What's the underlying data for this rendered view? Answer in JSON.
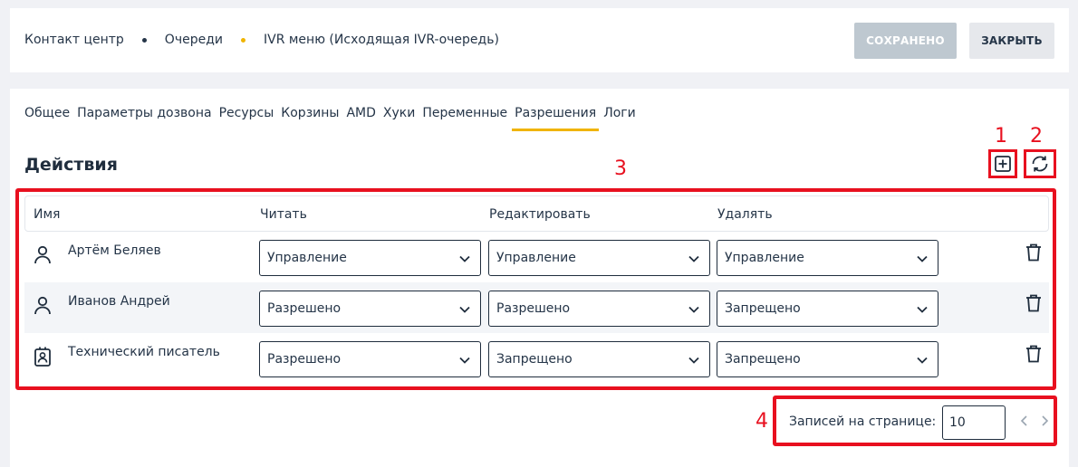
{
  "breadcrumb": {
    "items": [
      "Контакт центр",
      "Очереди",
      "IVR меню (Исходящая IVR-очередь)"
    ],
    "dot_colors": [
      "#253548",
      "#f0b400"
    ]
  },
  "toolbar": {
    "saved_label": "СОХРАНЕНО",
    "close_label": "ЗАКРЫТЬ"
  },
  "tabs": [
    "Общее",
    "Параметры дозвона",
    "Ресурсы",
    "Корзины",
    "AMD",
    "Хуки",
    "Переменные",
    "Разрешения",
    "Логи"
  ],
  "active_tab": "Разрешения",
  "section": {
    "title": "Действия",
    "add_icon": "plus-square-icon",
    "refresh_icon": "refresh-icon"
  },
  "annotations": {
    "n1": "1",
    "n2": "2",
    "n3": "3",
    "n4": "4",
    "color": "#e8101f"
  },
  "table": {
    "columns": [
      "Имя",
      "Читать",
      "Редактировать",
      "Удалять"
    ],
    "rows": [
      {
        "name": "Артём Беляев",
        "icon": "user-icon",
        "read": "Управление",
        "edit": "Управление",
        "delete": "Управление"
      },
      {
        "name": "Иванов Андрей",
        "icon": "user-icon",
        "read": "Разрешено",
        "edit": "Разрешено",
        "delete": "Запрещено"
      },
      {
        "name": "Технический писатель",
        "icon": "role-badge-icon",
        "read": "Разрешено",
        "edit": "Запрещено",
        "delete": "Запрещено"
      }
    ]
  },
  "pagination": {
    "label": "Записей на странице:",
    "per_page": "10"
  }
}
